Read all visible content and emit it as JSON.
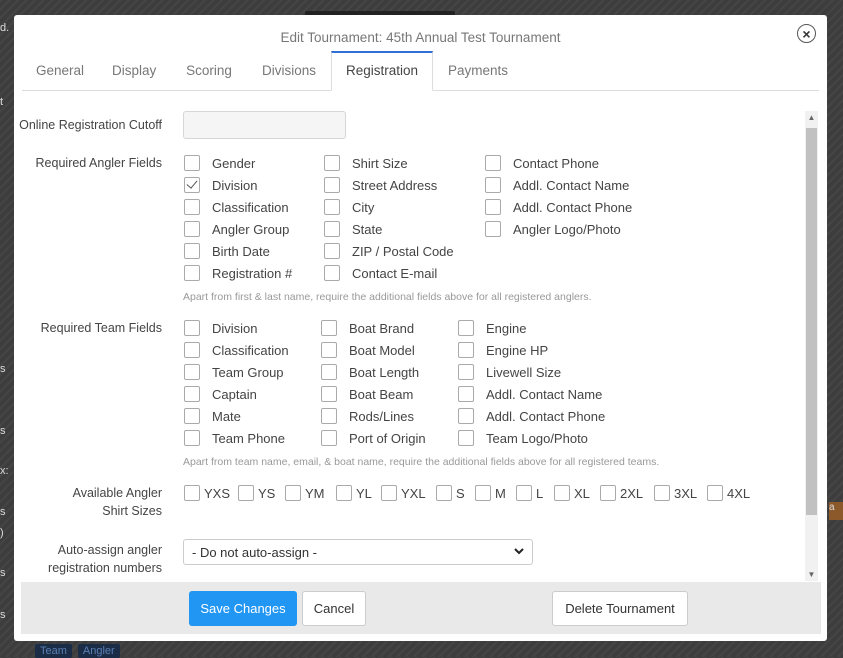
{
  "modal": {
    "title": "Edit Tournament: 45th Annual Test Tournament",
    "close_symbol": "×"
  },
  "tabs": [
    {
      "label": "General",
      "active": false
    },
    {
      "label": "Display",
      "active": false
    },
    {
      "label": "Scoring",
      "active": false
    },
    {
      "label": "Divisions",
      "active": false
    },
    {
      "label": "Registration",
      "active": true
    },
    {
      "label": "Payments",
      "active": false
    }
  ],
  "registration": {
    "cutoff_label": "Online Registration Cutoff",
    "cutoff_value": "",
    "angler_fields_label": "Required Angler Fields",
    "angler_fields": [
      {
        "label": "Gender",
        "checked": false
      },
      {
        "label": "Division",
        "checked": true
      },
      {
        "label": "Classification",
        "checked": false
      },
      {
        "label": "Angler Group",
        "checked": false
      },
      {
        "label": "Birth Date",
        "checked": false
      },
      {
        "label": "Registration #",
        "checked": false
      },
      {
        "label": "Shirt Size",
        "checked": false
      },
      {
        "label": "Street Address",
        "checked": false
      },
      {
        "label": "City",
        "checked": false
      },
      {
        "label": "State",
        "checked": false
      },
      {
        "label": "ZIP / Postal Code",
        "checked": false
      },
      {
        "label": "Contact E-mail",
        "checked": false
      },
      {
        "label": "Contact Phone",
        "checked": false
      },
      {
        "label": "Addl. Contact Name",
        "checked": false
      },
      {
        "label": "Addl. Contact Phone",
        "checked": false
      },
      {
        "label": "Angler Logo/Photo",
        "checked": false
      }
    ],
    "angler_help": "Apart from first & last name, require the additional fields above for all registered anglers.",
    "team_fields_label": "Required Team Fields",
    "team_fields": [
      {
        "label": "Division",
        "checked": false
      },
      {
        "label": "Classification",
        "checked": false
      },
      {
        "label": "Team Group",
        "checked": false
      },
      {
        "label": "Captain",
        "checked": false
      },
      {
        "label": "Mate",
        "checked": false
      },
      {
        "label": "Team Phone",
        "checked": false
      },
      {
        "label": "Boat Brand",
        "checked": false
      },
      {
        "label": "Boat Model",
        "checked": false
      },
      {
        "label": "Boat Length",
        "checked": false
      },
      {
        "label": "Boat Beam",
        "checked": false
      },
      {
        "label": "Rods/Lines",
        "checked": false
      },
      {
        "label": "Port of Origin",
        "checked": false
      },
      {
        "label": "Engine",
        "checked": false
      },
      {
        "label": "Engine HP",
        "checked": false
      },
      {
        "label": "Livewell Size",
        "checked": false
      },
      {
        "label": "Addl. Contact Name",
        "checked": false
      },
      {
        "label": "Addl. Contact Phone",
        "checked": false
      },
      {
        "label": "Team Logo/Photo",
        "checked": false
      }
    ],
    "team_help": "Apart from team name, email, & boat name, require the additional fields above for all registered teams.",
    "shirt_sizes_label_line1": "Available Angler",
    "shirt_sizes_label_line2": "Shirt Sizes",
    "shirt_sizes": [
      {
        "label": "YXS",
        "checked": false
      },
      {
        "label": "YS",
        "checked": false
      },
      {
        "label": "YM",
        "checked": false
      },
      {
        "label": "YL",
        "checked": false
      },
      {
        "label": "YXL",
        "checked": false
      },
      {
        "label": "S",
        "checked": false
      },
      {
        "label": "M",
        "checked": false
      },
      {
        "label": "L",
        "checked": false
      },
      {
        "label": "XL",
        "checked": false
      },
      {
        "label": "2XL",
        "checked": false
      },
      {
        "label": "3XL",
        "checked": false
      },
      {
        "label": "4XL",
        "checked": false
      }
    ],
    "auto_assign_label_line1": "Auto-assign angler",
    "auto_assign_label_line2": "registration numbers",
    "auto_assign_selected": "- Do not auto-assign -"
  },
  "footer": {
    "save_label": "Save Changes",
    "cancel_label": "Cancel",
    "delete_label": "Delete Tournament"
  },
  "background": {
    "chip_team": "Team",
    "chip_angler": "Angler",
    "left_fragments": [
      "d.",
      "t",
      "s",
      "s",
      "x:",
      "s",
      ")",
      "s",
      "s"
    ],
    "right_fragment": "a"
  },
  "colors": {
    "primary": "#2196f3",
    "tab_active_border": "#2f6fd6",
    "footer_bg": "#e9e9e9"
  }
}
